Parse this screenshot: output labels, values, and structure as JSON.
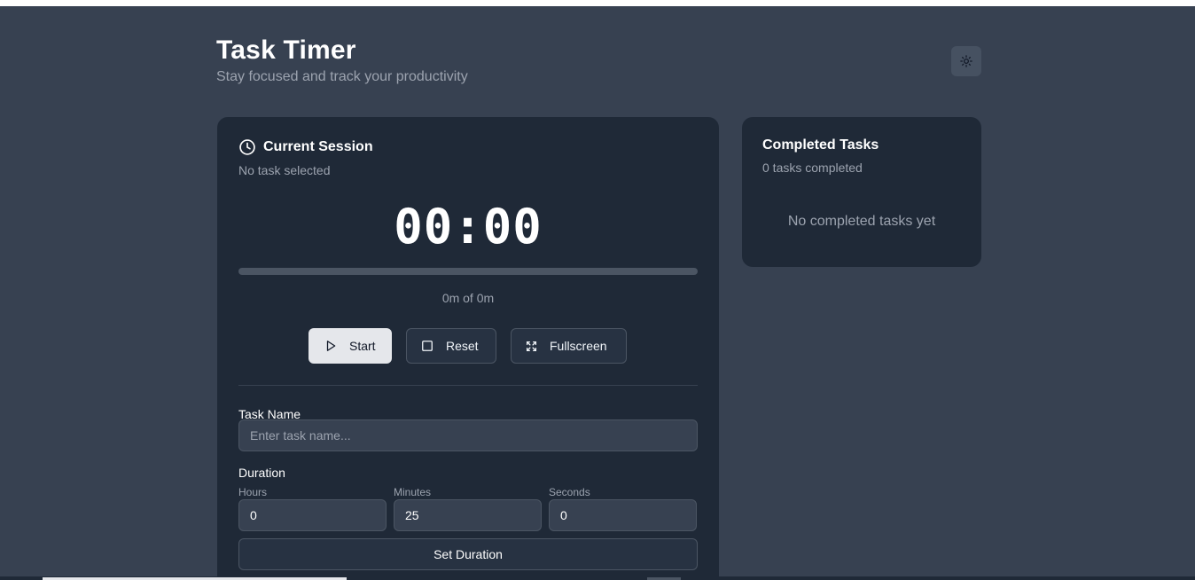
{
  "header": {
    "title": "Task Timer",
    "subtitle": "Stay focused and track your productivity",
    "theme_toggle_icon": "sun-icon"
  },
  "session": {
    "title": "Current Session",
    "icon": "clock-icon",
    "task_status": "No task selected",
    "timer_display": "00:00",
    "progress_fraction": 0,
    "progress_text": "0m of 0m",
    "buttons": {
      "start": "Start",
      "reset": "Reset",
      "fullscreen": "Fullscreen"
    },
    "form": {
      "task_name_label": "Task Name",
      "task_name_placeholder": "Enter task name...",
      "task_name_value": "",
      "duration_label": "Duration",
      "hours_label": "Hours",
      "hours_value": "0",
      "minutes_label": "Minutes",
      "minutes_value": "25",
      "seconds_label": "Seconds",
      "seconds_value": "0",
      "set_duration_label": "Set Duration"
    }
  },
  "completed": {
    "title": "Completed Tasks",
    "count_text": "0 tasks completed",
    "empty_text": "No completed tasks yet"
  },
  "colors": {
    "page_bg": "#374151",
    "card_bg": "#1f2937",
    "primary_button_bg": "#e5e7eb",
    "muted_text": "#9ca3af"
  }
}
